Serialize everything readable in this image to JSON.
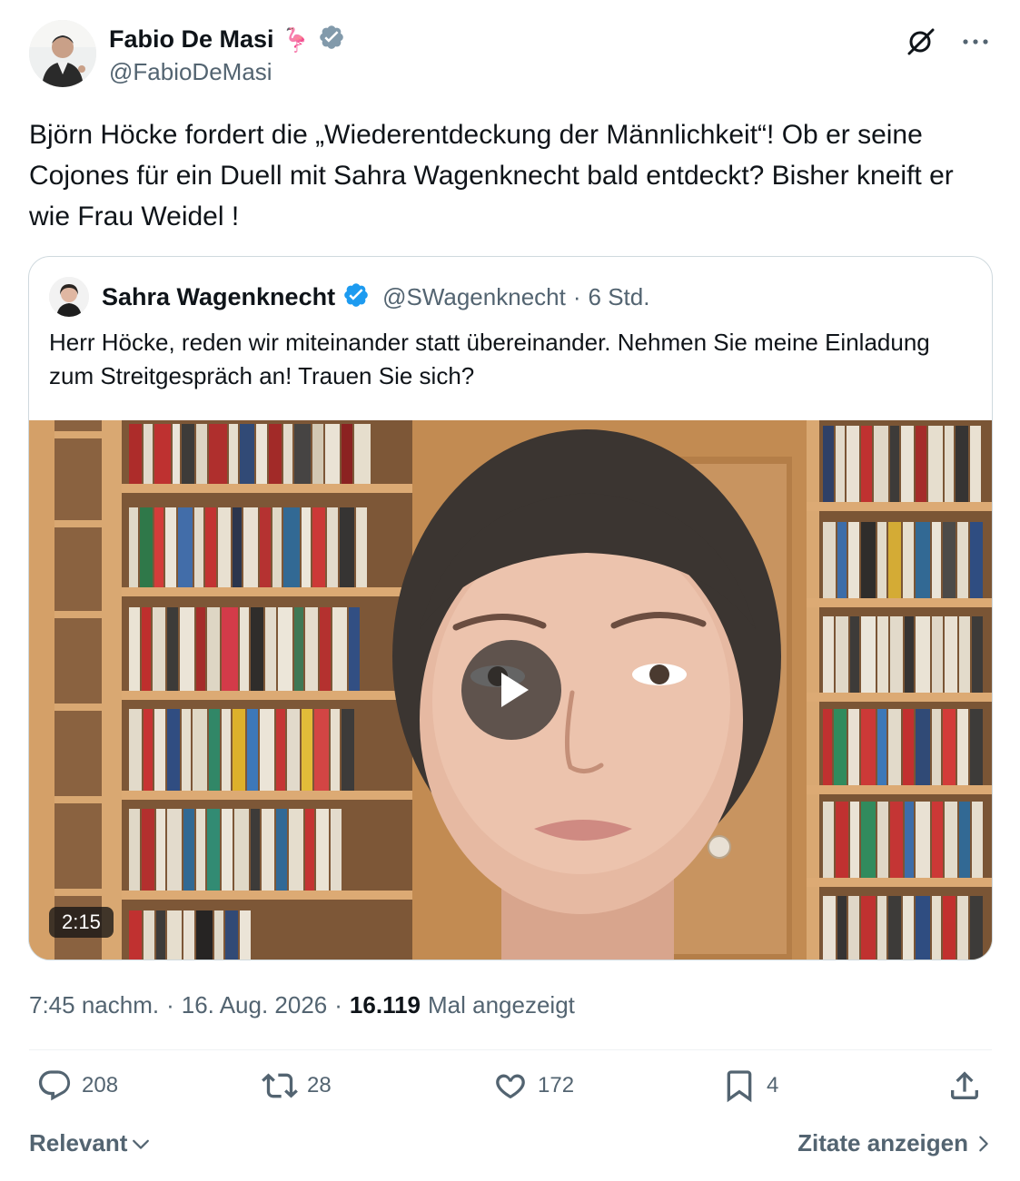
{
  "author": {
    "name": "Fabio De Masi",
    "emoji": "🦩",
    "handle": "@FabioDeMasi"
  },
  "tweet": {
    "text": "Björn Höcke fordert die „Wiederentdeckung der Männlichkeit“! Ob er seine Cojones für ein Duell mit Sahra Wagenknecht bald entdeckt? Bisher kneift er wie Frau Weidel !"
  },
  "quote": {
    "name": "Sahra Wagenknecht",
    "handle": "@SWagenknecht",
    "separator": "·",
    "time": "6 Std.",
    "text": "Herr Höcke, reden wir miteinander statt übereinander. Nehmen Sie meine Einladung zum Streitgespräch an! Trauen Sie sich?",
    "video": {
      "duration": "2:15"
    }
  },
  "meta": {
    "time": "7:45 nachm.",
    "sep1": "·",
    "date": "16. Aug. 2026",
    "sep2": "·",
    "views": "16.119",
    "views_label": "Mal angezeigt"
  },
  "actions": {
    "replies": "208",
    "reposts": "28",
    "likes": "172",
    "bookmarks": "4"
  },
  "footer": {
    "sort": "Relevant",
    "quotes_link": "Zitate anzeigen"
  },
  "colors": {
    "verified_grey": "#829aab",
    "verified_blue": "#1d9bf0",
    "muted": "#536471"
  }
}
